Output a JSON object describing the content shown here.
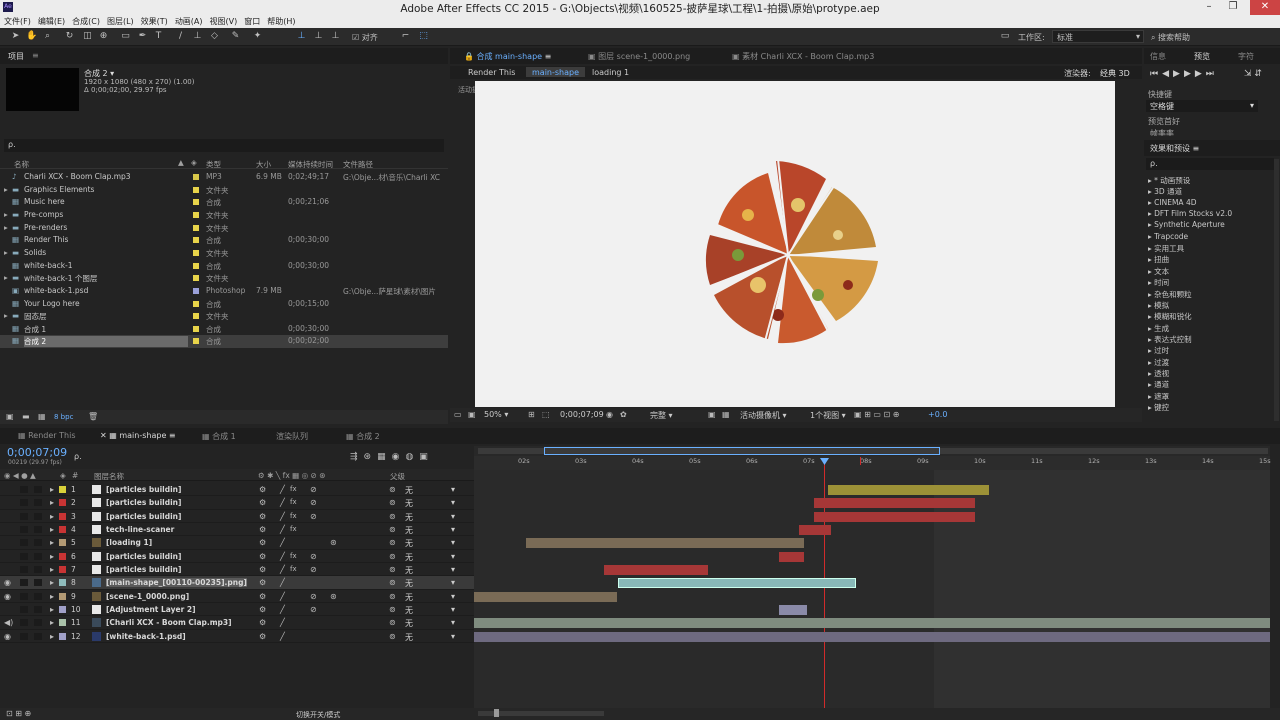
{
  "window": {
    "title": "Adobe After Effects CC 2015 - G:\\Objects\\视频\\160525-披萨星球\\工程\\1-拍摄\\原始\\protype.aep",
    "app_icon": "Ae"
  },
  "menu": [
    "文件(F)",
    "编辑(E)",
    "合成(C)",
    "图层(L)",
    "效果(T)",
    "动画(A)",
    "视图(V)",
    "窗口",
    "帮助(H)"
  ],
  "toolbar": {
    "snap_label": "对齐",
    "workspace_label": "工作区:",
    "workspace_value": "标准",
    "search_help": "搜索帮助"
  },
  "project": {
    "tab": "项目",
    "comp_name": "合成 2 ▾",
    "comp_info1": "1920 x 1080  (480 x 270) (1.00)",
    "comp_info2": "Δ 0;00;02;00, 29.97 fps",
    "search_placeholder": "ρ.",
    "headers": [
      "名称",
      "类型",
      "大小",
      "媒体持续时间",
      "文件路径"
    ],
    "items": [
      {
        "name": "Charli XCX - Boom Clap.mp3",
        "type": "MP3",
        "size": "6.9 MB",
        "dur": "0;02;49;17",
        "path": "G:\\Obje...材\\音乐\\Charli XC",
        "color": "#d8c84a",
        "icon": "audio-file-icon"
      },
      {
        "name": "Graphics Elements",
        "type": "文件夹",
        "size": "",
        "dur": "",
        "path": "",
        "color": "#e8d44a",
        "icon": "folder-icon"
      },
      {
        "name": "Music here",
        "type": "合成",
        "size": "",
        "dur": "0;00;21;06",
        "path": "",
        "color": "#e8d44a",
        "icon": "composition-icon"
      },
      {
        "name": "Pre-comps",
        "type": "文件夹",
        "size": "",
        "dur": "",
        "path": "",
        "color": "#e8d44a",
        "icon": "folder-icon"
      },
      {
        "name": "Pre-renders",
        "type": "文件夹",
        "size": "",
        "dur": "",
        "path": "",
        "color": "#e8d44a",
        "icon": "folder-icon"
      },
      {
        "name": "Render This",
        "type": "合成",
        "size": "",
        "dur": "0;00;30;00",
        "path": "",
        "color": "#e8d44a",
        "icon": "composition-icon"
      },
      {
        "name": "Solids",
        "type": "文件夹",
        "size": "",
        "dur": "",
        "path": "",
        "color": "#e8d44a",
        "icon": "folder-icon"
      },
      {
        "name": "white-back-1",
        "type": "合成",
        "size": "",
        "dur": "0;00;30;00",
        "path": "",
        "color": "#e8d44a",
        "icon": "composition-icon"
      },
      {
        "name": "white-back-1 个图层",
        "type": "文件夹",
        "size": "",
        "dur": "",
        "path": "",
        "color": "#e8d44a",
        "icon": "folder-icon"
      },
      {
        "name": "white-back-1.psd",
        "type": "Photoshop",
        "size": "7.9 MB",
        "dur": "",
        "path": "G:\\Obje...萨星球\\素材\\图片",
        "color": "#9aa0d8",
        "icon": "psd-file-icon"
      },
      {
        "name": "Your Logo here",
        "type": "合成",
        "size": "",
        "dur": "0;00;15;00",
        "path": "",
        "color": "#e8d44a",
        "icon": "composition-icon"
      },
      {
        "name": "固态层",
        "type": "文件夹",
        "size": "",
        "dur": "",
        "path": "",
        "color": "#e8d44a",
        "icon": "folder-icon"
      },
      {
        "name": "合成 1",
        "type": "合成",
        "size": "",
        "dur": "0;00;30;00",
        "path": "",
        "color": "#e8d44a",
        "icon": "composition-icon"
      },
      {
        "name": "合成 2",
        "type": "合成",
        "size": "",
        "dur": "0;00;02;00",
        "path": "",
        "color": "#e8d44a",
        "icon": "composition-icon"
      }
    ],
    "footer_bpc": "8 bpc"
  },
  "viewer": {
    "tabs": [
      "合成 main-shape",
      "图层 scene-1_0000.png",
      "素材 Charli XCX - Boom Clap.mp3"
    ],
    "breadcrumbs": [
      "Render This",
      "main-shape",
      "loading 1"
    ],
    "renderer_label": "渲染器:",
    "renderer_value": "经典 3D",
    "camera_label": "活动摄像机",
    "zoom": "50%",
    "timecode": "0;00;07;09",
    "quality": "完整",
    "camera_select": "活动摄像机",
    "views": "1个视图",
    "exposure": "+0.0"
  },
  "preview": {
    "tabs": [
      "信息",
      "预览",
      "字符"
    ],
    "shortcut_label": "快捷键",
    "shortcut_value": "空格键",
    "pref_label": "预览首好",
    "pref_value": "帧率率"
  },
  "effects": {
    "title": "效果和预设",
    "search_placeholder": "ρ.",
    "items": [
      "* 动画预设",
      "3D 通道",
      "CINEMA 4D",
      "DFT Film Stocks v2.0",
      "Synthetic Aperture",
      "Trapcode",
      "实用工具",
      "扭曲",
      "文本",
      "时间",
      "杂色和颗粒",
      "模拟",
      "模糊和锐化",
      "生成",
      "表达式控制",
      "过时",
      "过渡",
      "透视",
      "通道",
      "遮罩",
      "键控"
    ]
  },
  "timeline": {
    "tabs": [
      "Render This",
      "main-shape",
      "合成 1",
      "渲染队列",
      "合成 2"
    ],
    "timecode": "0;00;07;09",
    "timecode_sub": "00219 (29.97 fps)",
    "search_placeholder": "ρ.",
    "col_hash": "#",
    "col_name": "图层名称",
    "col_parent": "父级",
    "ruler": [
      "02s",
      "03s",
      "04s",
      "05s",
      "06s",
      "07s",
      "08s",
      "09s",
      "10s",
      "11s",
      "12s",
      "13s",
      "14s",
      "15s"
    ],
    "layers": [
      {
        "num": "1",
        "name": "[particles buildin]",
        "color": "#d9d13a",
        "parent": "无",
        "bar_color": "#9c9137"
      },
      {
        "num": "2",
        "name": "[particles buildin]",
        "color": "#c83434",
        "parent": "无",
        "bar_color": "#a63737"
      },
      {
        "num": "3",
        "name": "[particles buildin]",
        "color": "#c83434",
        "parent": "无",
        "bar_color": "#a63737"
      },
      {
        "num": "4",
        "name": "tech-line-scaner",
        "color": "#c83434",
        "parent": "无",
        "bar_color": "#a63737"
      },
      {
        "num": "5",
        "name": "[loading 1]",
        "color": "#b39a74",
        "parent": "无",
        "bar_color": "#7a6b56"
      },
      {
        "num": "6",
        "name": "[particles buildin]",
        "color": "#c83434",
        "parent": "无",
        "bar_color": "#a63737"
      },
      {
        "num": "7",
        "name": "[particles buildin]",
        "color": "#c83434",
        "parent": "无",
        "bar_color": "#a63737"
      },
      {
        "num": "8",
        "name": "[main-shape_[00110-00235].png]",
        "color": "#8fbcbc",
        "parent": "无",
        "bar_color": "#88b8b8"
      },
      {
        "num": "9",
        "name": "[scene-1_0000.png]",
        "color": "#b39a74",
        "parent": "无",
        "bar_color": "#7a6b56"
      },
      {
        "num": "10",
        "name": "[Adjustment Layer 2]",
        "color": "#a0a0c8",
        "parent": "无",
        "bar_color": "#8a8aa8"
      },
      {
        "num": "11",
        "name": "[Charli XCX - Boom Clap.mp3]",
        "color": "#a8c0a8",
        "parent": "无",
        "bar_color": "#7f8c7f"
      },
      {
        "num": "12",
        "name": "[white-back-1.psd]",
        "color": "#a0a0c8",
        "parent": "无",
        "bar_color": "#6e6a80"
      }
    ],
    "footer_label": "切换开关/模式"
  }
}
